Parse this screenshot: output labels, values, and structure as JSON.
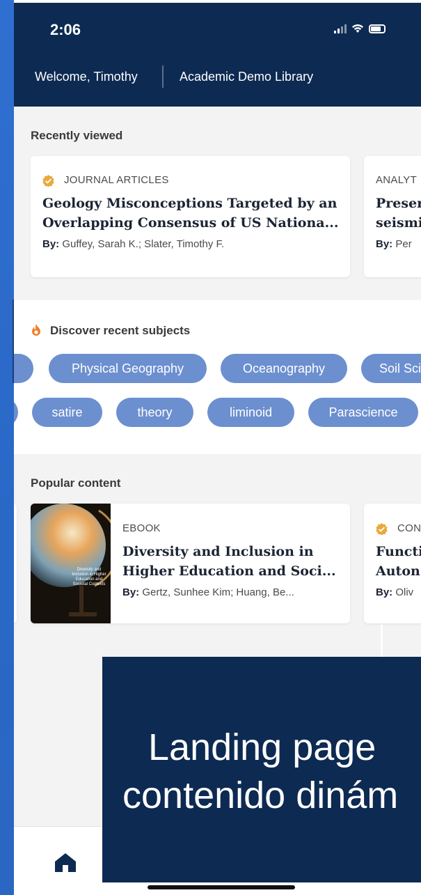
{
  "status_bar": {
    "time": "2:06"
  },
  "header": {
    "welcome": "Welcome, Timothy",
    "library": "Academic Demo Library"
  },
  "recently_viewed": {
    "title": "Recently viewed",
    "cards": [
      {
        "type": "JOURNAL ARTICLES",
        "title_line1": "Geology Misconceptions Targeted by an",
        "title_line2": "Overlapping Consensus of US Nationa...",
        "by_label": "By:",
        "authors": "Guffey, Sarah K.; Slater, Timothy F."
      },
      {
        "type": "ANALYT",
        "title_line1": "Preser",
        "title_line2": "seismi",
        "by_label": "By:",
        "authors": "Per"
      }
    ]
  },
  "discover": {
    "title": "Discover recent subjects",
    "row1": [
      "Physical Geography",
      "Oceanography",
      "Soil Sci"
    ],
    "row2": [
      "satire",
      "theory",
      "liminoid",
      "Parascience"
    ]
  },
  "popular": {
    "title": "Popular content",
    "cards": [
      {
        "type": "EBOOK",
        "title_line1": "Diversity and Inclusion in",
        "title_line2": "Higher Education and Soci...",
        "by_label": "By:",
        "authors": "Gertz, Sunhee Kim; Huang, Be...",
        "cover_text": "Diversity and Inclusion in Higher Education and Societal Contexts"
      },
      {
        "type": "CON",
        "title_line1": "Functi",
        "title_line2": "Auton",
        "by_label": "By:",
        "authors": "Oliv"
      }
    ]
  },
  "overlay": {
    "line1": "Landing page",
    "line2": "contenido dinám"
  },
  "nav": {
    "home": "home-icon"
  },
  "colors": {
    "header": "#0d2a52",
    "chip": "#6c8fcf",
    "badge": "#e9a93b",
    "accent_left": "#2f6fd0"
  }
}
